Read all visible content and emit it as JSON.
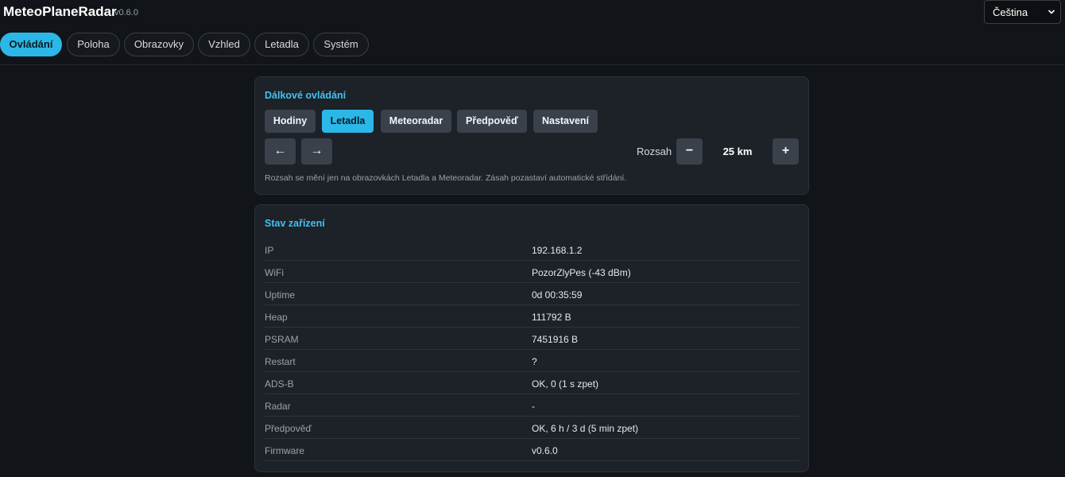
{
  "header": {
    "app_title": "MeteoPlaneRadar",
    "version": "v0.6.0",
    "language": "Čeština"
  },
  "tabs": [
    {
      "label": "Ovládání",
      "active": true
    },
    {
      "label": "Poloha",
      "active": false
    },
    {
      "label": "Obrazovky",
      "active": false
    },
    {
      "label": "Vzhled",
      "active": false
    },
    {
      "label": "Letadla",
      "active": false
    },
    {
      "label": "Systém",
      "active": false
    }
  ],
  "remote": {
    "title": "Dálkové ovládání",
    "screens": [
      {
        "label": "Hodiny",
        "active": false
      },
      {
        "label": "Letadla",
        "active": true
      },
      {
        "label": "Meteoradar",
        "active": false
      },
      {
        "label": "Předpověď",
        "active": false
      },
      {
        "label": "Nastavení",
        "active": false
      }
    ],
    "prev_label": "←",
    "next_label": "→",
    "range_label": "Rozsah",
    "range_minus": "−",
    "range_value": "25 km",
    "range_plus": "+",
    "hint": "Rozsah se mění jen na obrazovkách Letadla a Meteoradar. Zásah pozastaví automatické střídání."
  },
  "status": {
    "title": "Stav zařízení",
    "rows": [
      {
        "key": "IP",
        "value": "192.168.1.2"
      },
      {
        "key": "WiFi",
        "value": "PozorZlyPes (-43 dBm)"
      },
      {
        "key": "Uptime",
        "value": "0d 00:35:59"
      },
      {
        "key": "Heap",
        "value": "111792 B"
      },
      {
        "key": "PSRAM",
        "value": "7451916 B"
      },
      {
        "key": "Restart",
        "value": "?"
      },
      {
        "key": "ADS-B",
        "value": "OK, 0 (1 s zpet)"
      },
      {
        "key": "Radar",
        "value": "-"
      },
      {
        "key": "Předpověď",
        "value": "OK, 6 h / 3 d (5 min zpet)"
      },
      {
        "key": "Firmware",
        "value": "v0.6.0"
      }
    ]
  },
  "colors": {
    "accent": "#2bb8e8",
    "background": "#111418",
    "card": "#1d2128",
    "button": "#3a414b"
  }
}
